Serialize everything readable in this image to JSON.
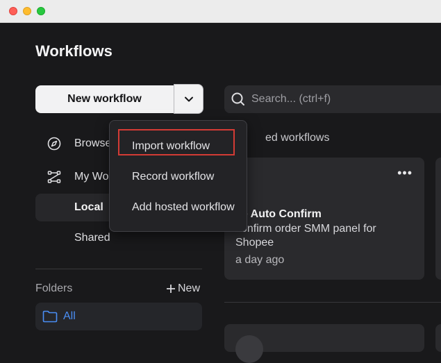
{
  "page": {
    "title": "Workflows"
  },
  "toolbar": {
    "new_workflow_label": "New workflow"
  },
  "search": {
    "placeholder": "Search... (ctrl+f)"
  },
  "dropdown_menu": {
    "items": [
      {
        "label": "Import workflow"
      },
      {
        "label": "Record workflow"
      },
      {
        "label": "Add hosted workflow"
      }
    ]
  },
  "sidebar": {
    "items": [
      {
        "label": "Browse",
        "icon": "compass-icon"
      },
      {
        "label": "My Wo",
        "icon": "workflow-icon"
      },
      {
        "label": "Local",
        "active": true
      },
      {
        "label": "Shared"
      }
    ]
  },
  "folders": {
    "label": "Folders",
    "new_label": "New",
    "all_label": "All"
  },
  "main": {
    "section_label": "ed workflows",
    "cards": [
      {
        "name": "ee Auto Confirm",
        "description": "confirm order SMM panel for Shopee",
        "time": "a day ago"
      }
    ]
  },
  "colors": {
    "accent": "#4a8ef5",
    "highlight_border": "#d43b35"
  }
}
